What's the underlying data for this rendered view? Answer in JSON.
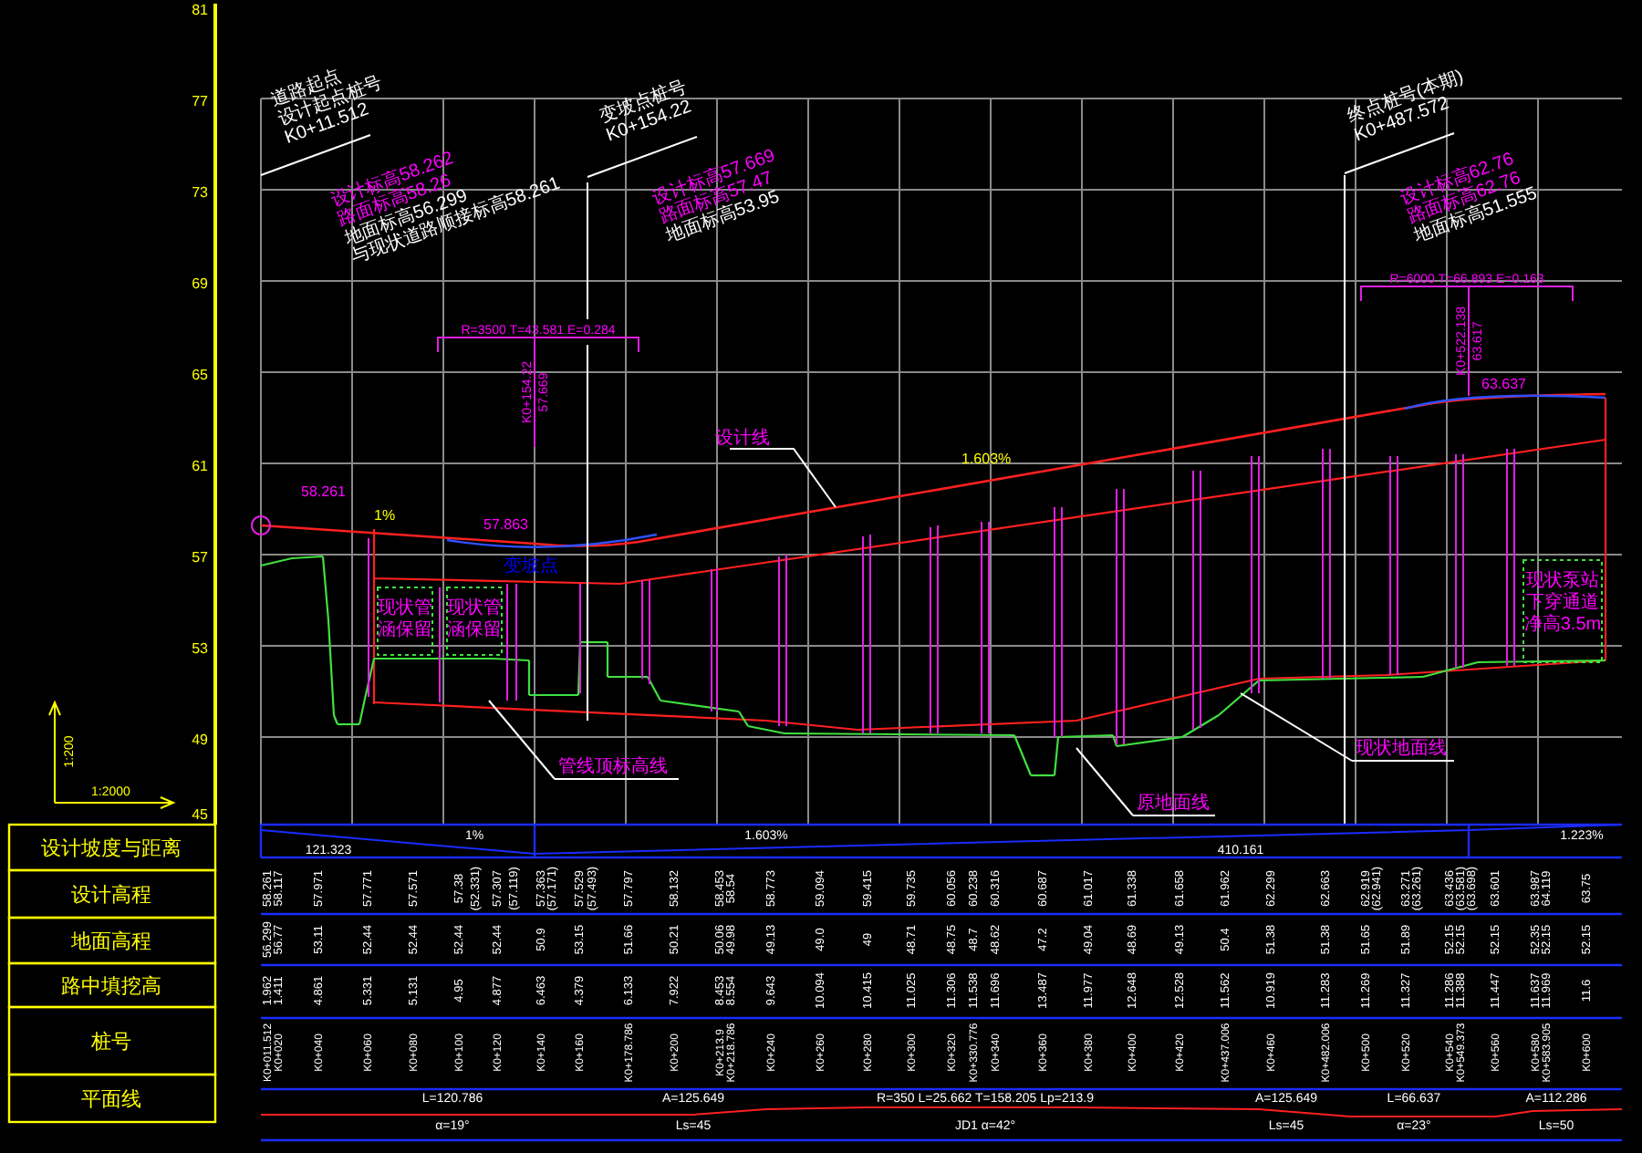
{
  "axis": {
    "ticks": [
      "81",
      "77",
      "73",
      "69",
      "65",
      "61",
      "57",
      "53",
      "49",
      "45"
    ]
  },
  "scale": {
    "vertical": "1:200",
    "horizontal": "1:2000"
  },
  "notes": [
    {
      "lines": [
        {
          "text": "道路起点",
          "color": "#ffffff"
        },
        {
          "text": "设计起点桩号",
          "color": "#ffffff"
        },
        {
          "text": "K0+11.512",
          "color": "#ffffff"
        },
        {
          "text": "设计标高58.262",
          "color": "#ff00ff"
        },
        {
          "text": "路面标高58.26",
          "color": "#ff00ff"
        },
        {
          "text": "地面标高56.299",
          "color": "#ffffff"
        },
        {
          "text": "与现状道路顺接标高58.261",
          "color": "#ffffff"
        }
      ]
    },
    {
      "lines": [
        {
          "text": "变坡点桩号",
          "color": "#ffffff"
        },
        {
          "text": "K0+154.22",
          "color": "#ffffff"
        },
        {
          "text": "设计标高57.669",
          "color": "#ff00ff"
        },
        {
          "text": "路面标高57.47",
          "color": "#ff00ff"
        },
        {
          "text": "地面标高53.95",
          "color": "#ffffff"
        }
      ]
    },
    {
      "lines": [
        {
          "text": "终点桩号(本期)",
          "color": "#ffffff"
        },
        {
          "text": "K0+487.572",
          "color": "#ffffff"
        },
        {
          "text": "设计标高62.76",
          "color": "#ff00ff"
        },
        {
          "text": "路面标高62.76",
          "color": "#ff00ff"
        },
        {
          "text": "地面标高51.555",
          "color": "#ffffff"
        }
      ]
    }
  ],
  "vertical_curves": [
    {
      "params": "R=3500 T=43.581 E=0.284",
      "station": "K0+154.22",
      "elevation": "57.669"
    },
    {
      "params": "R=6000 T=66.893 E=0.163",
      "station": "K0+522.138",
      "elevation": "63.617"
    }
  ],
  "profile_labels": [
    {
      "text": "58.261",
      "color": "#ff00ff"
    },
    {
      "text": "1%",
      "color": "#ffff00"
    },
    {
      "text": "57.863",
      "color": "#ff00ff"
    },
    {
      "text": "变坡点",
      "color": "#0000ff"
    },
    {
      "text": "设计线",
      "color": "#ff00ff"
    },
    {
      "text": "1.603%",
      "color": "#ffff00"
    },
    {
      "text": "63.637",
      "color": "#ff00ff"
    },
    {
      "text": "管线顶标高线",
      "color": "#ff00ff"
    },
    {
      "text": "原地面线",
      "color": "#ff00ff"
    },
    {
      "text": "现状地面线",
      "color": "#ff00ff"
    }
  ],
  "boxes": [
    {
      "lines": [
        "现状管",
        "涵保留"
      ]
    },
    {
      "lines": [
        "现状管",
        "涵保留"
      ]
    },
    {
      "lines": [
        "现状泵站",
        "下穿通道",
        "净高3.5m"
      ]
    }
  ],
  "table": {
    "row_labels": [
      "设计坡度与距离",
      "设计高程",
      "地面高程",
      "路中填挖高",
      "桩号",
      "平面线"
    ],
    "slopes": [
      {
        "grade": "1%",
        "length": "121.323"
      },
      {
        "grade": "1.603%",
        "length": "410.161"
      },
      {
        "grade": "1.223%"
      }
    ],
    "columns": [
      {
        "design": "58.261",
        "ground": "56.299",
        "fill": "1.962",
        "station": "K0+011.512"
      },
      {
        "design": "58.117",
        "ground": "56.77",
        "fill": "1.411",
        "station": "K0+020"
      },
      {
        "design": "57.971",
        "ground": "53.11",
        "fill": "4.861",
        "station": "K0+040"
      },
      {
        "design": "57.771",
        "ground": "52.44",
        "fill": "5.331",
        "station": "K0+060"
      },
      {
        "design": "57.571",
        "ground": "52.44",
        "fill": "5.131",
        "station": "K0+080"
      },
      {
        "design": "57.38",
        "ground": "52.44",
        "fill": "4.95",
        "station": "K0+100"
      },
      {
        "design": "(52.331)"
      },
      {
        "design": "57.307",
        "ground": "52.44",
        "fill": "4.877",
        "station": "K0+120"
      },
      {
        "design": "(57.119)"
      },
      {
        "design": "57.363",
        "ground": "50.9",
        "fill": "6.463",
        "station": "K0+140"
      },
      {
        "design": "(57.171)"
      },
      {
        "design": "57.529",
        "ground": "53.15",
        "fill": "4.379",
        "station": "K0+160"
      },
      {
        "design": "(57.493)"
      },
      {
        "design": "57.797",
        "ground": "51.66",
        "fill": "6.133",
        "station": "K0+178.786"
      },
      {
        "design": "58.132",
        "ground": "50.21",
        "fill": "7.922",
        "station": "K0+200"
      },
      {
        "design": "58.453",
        "ground": "50.06",
        "fill": "8.453",
        "station": "K0+213.9"
      },
      {
        "design": "58.54",
        "ground": "49.98",
        "fill": "8.554",
        "station": "K0+218.786"
      },
      {
        "design": "58.773",
        "ground": "49.13",
        "fill": "9.643",
        "station": "K0+240"
      },
      {
        "design": "59.094",
        "ground": "49.0",
        "fill": "10.094",
        "station": "K0+260"
      },
      {
        "design": "59.415",
        "ground": "49",
        "fill": "10.415",
        "station": "K0+280"
      },
      {
        "design": "59.735",
        "ground": "48.71",
        "fill": "11.025",
        "station": "K0+300"
      },
      {
        "design": "60.056",
        "ground": "48.75",
        "fill": "11.306",
        "station": "K0+320"
      },
      {
        "design": "60.238",
        "ground": "48.7",
        "fill": "11.538",
        "station": "K0+330.776"
      },
      {
        "design": "60.316",
        "ground": "48.62",
        "fill": "11.696",
        "station": "K0+340"
      },
      {
        "design": "60.687",
        "ground": "47.2",
        "fill": "13.487",
        "station": "K0+360"
      },
      {
        "design": "61.017",
        "ground": "49.04",
        "fill": "11.977",
        "station": "K0+380"
      },
      {
        "design": "61.338",
        "ground": "48.69",
        "fill": "12.648",
        "station": "K0+400"
      },
      {
        "design": "61.658",
        "ground": "49.13",
        "fill": "12.528",
        "station": "K0+420"
      },
      {
        "design": "61.962",
        "ground": "50.4",
        "fill": "11.562",
        "station": "K0+437.006"
      },
      {
        "design": "62.299",
        "ground": "51.38",
        "fill": "10.919",
        "station": "K0+460"
      },
      {
        "design": "62.663",
        "ground": "51.38",
        "fill": "11.283",
        "station": "K0+482.006"
      },
      {
        "design": "62.919",
        "ground": "51.65",
        "fill": "11.269",
        "station": "K0+500"
      },
      {
        "design": "(62.941)"
      },
      {
        "design": "63.271",
        "ground": "51.89",
        "fill": "11.327",
        "station": "K0+520"
      },
      {
        "design": "(63.261)"
      },
      {
        "design": "63.436",
        "ground": "52.15",
        "fill": "11.286",
        "station": "K0+540"
      },
      {
        "design": "(63.581)",
        "ground": "52.15",
        "fill": "11.388",
        "station": "K0+549.373"
      },
      {
        "design": "(63.698)"
      },
      {
        "design": "63.601",
        "ground": "52.15",
        "fill": "11.447",
        "station": "K0+560"
      },
      {
        "design": "63.987",
        "ground": "52.35",
        "fill": "11.637",
        "station": "K0+580"
      },
      {
        "design": "64.119",
        "ground": "52.15",
        "fill": "11.969",
        "station": "K0+583.905"
      },
      {
        "design": "63.75",
        "ground": "52.15",
        "fill": "11.6",
        "station": "K0+600"
      }
    ],
    "plane_curves": [
      {
        "line_1": "L=120.786",
        "line_2": "α=19°"
      },
      {
        "line_1": "A=125.649",
        "line_2": "Ls=45"
      },
      {
        "line_1": "R=350 L=25.662 T=158.205 Lp=213.9",
        "line_2": "JD1 α=42°"
      },
      {
        "line_1": "A=125.649",
        "line_2": "Ls=45"
      },
      {
        "line_1": "L=66.637",
        "line_2": "α=23°"
      },
      {
        "line_1": "A=112.286",
        "line_2": "Ls=50"
      }
    ]
  }
}
